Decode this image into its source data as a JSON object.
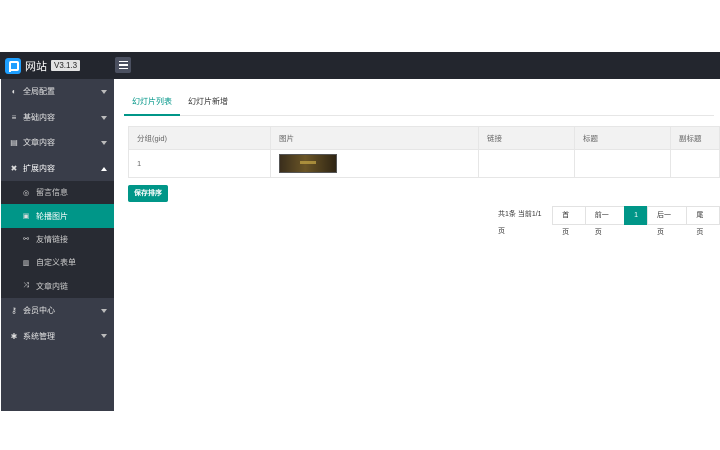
{
  "header": {
    "site_name": "网站",
    "version": "V3.1.3",
    "icons": {
      "logo": "logo-p-icon",
      "menu": "hamburger-icon"
    }
  },
  "sidebar": {
    "items": [
      {
        "label": "全局配置",
        "icon": "◐"
      },
      {
        "label": "基础内容",
        "icon": "≡"
      },
      {
        "label": "文章内容",
        "icon": "▤"
      },
      {
        "label": "扩展内容",
        "icon": "✖",
        "open": true,
        "children": [
          {
            "label": "留言信息",
            "icon": "◎"
          },
          {
            "label": "轮播图片",
            "icon": "▣",
            "active": true
          },
          {
            "label": "友情链接",
            "icon": "⚯"
          },
          {
            "label": "自定义表单",
            "icon": "▥"
          },
          {
            "label": "文章内链",
            "icon": "⤨"
          }
        ]
      },
      {
        "label": "会员中心",
        "icon": "⚷"
      },
      {
        "label": "系统管理",
        "icon": "✱"
      }
    ]
  },
  "tabs": {
    "list": "幻灯片列表",
    "add": "幻灯片新增"
  },
  "table": {
    "headers": [
      "分组(gid)",
      "图片",
      "链接",
      "标题",
      "副标题"
    ],
    "rows": [
      {
        "gid": "1",
        "link": "",
        "title": "",
        "subtitle": ""
      }
    ]
  },
  "actions": {
    "save_order": "保存排序"
  },
  "pagination": {
    "info": "共1条 当前1/1页",
    "first": "首页",
    "prev": "前一页",
    "current": "1",
    "next": "后一页",
    "last": "尾页"
  },
  "colors": {
    "accent": "#009688",
    "sidebar": "#393d49",
    "topbar": "#23262e"
  }
}
